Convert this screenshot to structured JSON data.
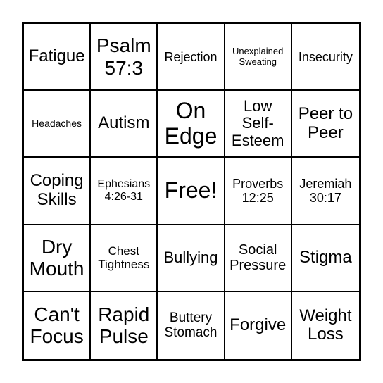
{
  "card": {
    "cells": [
      "Fatigue",
      "Psalm 57:3",
      "Rejection",
      "Unexplained Sweating",
      "Insecurity",
      "Headaches",
      "Autism",
      "On Edge",
      "Low Self-Esteem",
      "Peer to Peer",
      "Coping Skills",
      "Ephesians 4:26-31",
      "Free!",
      "Proverbs 12:25",
      "Jeremiah 30:17",
      "Dry Mouth",
      "Chest Tightness",
      "Bullying",
      "Social Pressure",
      "Stigma",
      "Can't Focus",
      "Rapid Pulse",
      "Buttery Stomach",
      "Forgive",
      "Weight Loss"
    ]
  }
}
